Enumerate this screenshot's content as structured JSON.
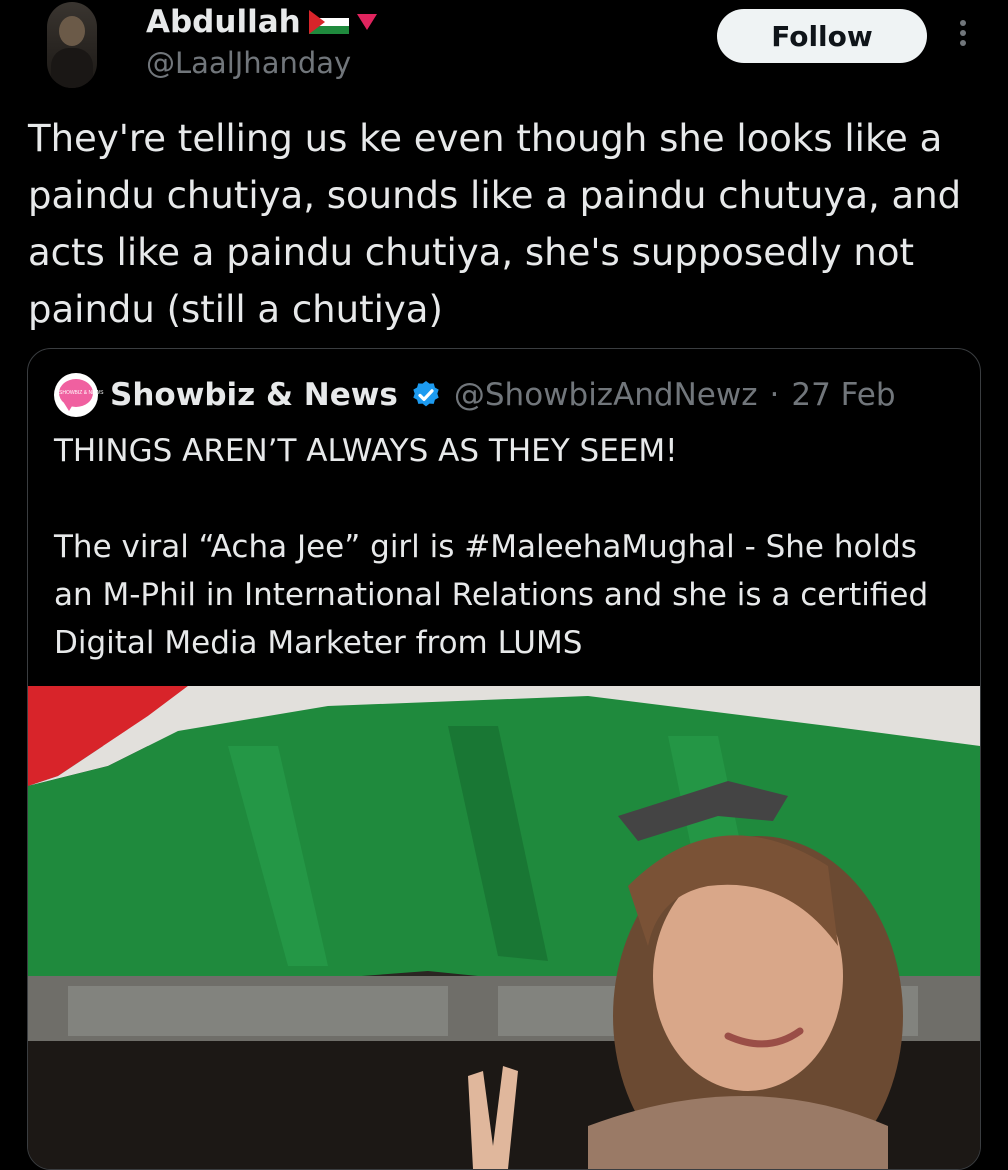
{
  "tweet": {
    "author_name": "Abdullah",
    "author_handle": "@LaalJhanday",
    "follow_label": "Follow",
    "text": "They're telling us ke even though she looks like a paindu chutiya, sounds like a paindu chutuya, and acts like a paindu chutiya, she's supposedly not paindu (still a chutiya)"
  },
  "quoted_tweet": {
    "author_name": "Showbiz & News",
    "author_handle": "@ShowbizAndNewz",
    "separator": "·",
    "date": "27 Feb",
    "avatar_text": "SHOWBIZ & NEWS",
    "text": "THINGS AREN’T ALWAYS AS THEY SEEM!\n\nThe viral “Acha Jee” girl is #MaleehaMughal - She holds an M-Phil in International Relations and she is a certified Digital Media Marketer from LUMS"
  },
  "icons": {
    "more": "more-vertical-icon",
    "verified": "verified-badge-icon",
    "flag": "palestine-flag-icon",
    "triangle": "red-triangle-icon"
  },
  "colors": {
    "background": "#000000",
    "text": "#e7e9ea",
    "secondary": "#71767b",
    "verified": "#1d9bf0",
    "follow_bg": "#eff3f4",
    "flag_green": "#1f8a3d",
    "flag_red": "#d8242a"
  }
}
